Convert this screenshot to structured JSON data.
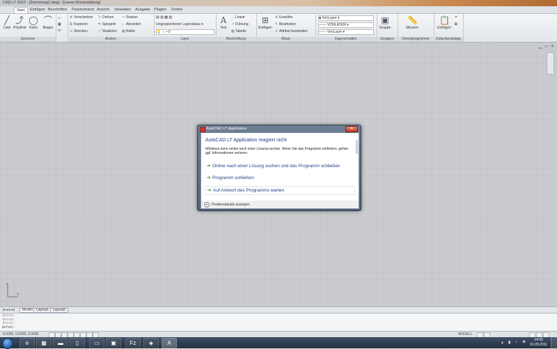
{
  "window": {
    "title": "CAD LT 2010 - [Zeichnung1.dwg] - [Leerer Rückmeldung]"
  },
  "ribbon_tabs": [
    "Start",
    "Einfügen",
    "Beschriften",
    "Parametrisch",
    "Ansicht",
    "Verwalten",
    "Ausgabe",
    "Plugins",
    "Online"
  ],
  "ribbon": {
    "zeichnen": {
      "title": "Zeichnen",
      "buttons": [
        "Linie",
        "Polylinie",
        "Kreis",
        "Bogen"
      ]
    },
    "aendern": {
      "title": "Ändern",
      "items": [
        "Verschieben",
        "Drehen",
        "Stutzen",
        "Kopieren",
        "Spiegeln",
        "Abrunden",
        "Strecken",
        "Skalieren",
        "Reihe"
      ]
    },
    "layer": {
      "title": "Layer",
      "items": [
        "Ungespeicherter Layerstatus",
        "0"
      ]
    },
    "beschriftung": {
      "title": "Beschriftung",
      "text_button": "Text",
      "items": [
        "Linear",
        "Führung",
        "Tabelle"
      ]
    },
    "block": {
      "title": "Block",
      "insert_button": "Einfügen",
      "items": [
        "Erstellen",
        "Bearbeiten",
        "Attribut bearbeiten"
      ]
    },
    "eigenschaften": {
      "title": "Eigenschaften",
      "items": [
        "VonLayer",
        "VONLAYER",
        "VonLayer"
      ]
    },
    "gruppen": {
      "title": "Gruppen",
      "button": "Gruppe"
    },
    "dienstprogramme": {
      "title": "Dienstprogramme",
      "button": "Messen"
    },
    "zwischenablage": {
      "title": "Zwischenablage",
      "button": "Einfügen"
    }
  },
  "layout_tabs": [
    "Modell",
    "Layout1",
    "Layout2"
  ],
  "command": {
    "history": [
      "Befehl:",
      "Befehl:",
      "Befehl:"
    ],
    "prompt": "Befehl:"
  },
  "statusbar": {
    "coords": "0.0000, 0.0000, 0.0000",
    "right_label": "MODELL"
  },
  "dialog": {
    "title": "AutoCAD LT Application",
    "close_symbol": "✕",
    "main_instruction": "AutoCAD LT Application reagiert nicht",
    "content": "Windows kann online nach einer Lösung suchen. Wenn Sie das Programm schließen, gehen ggf. Informationen verloren.",
    "options": [
      "Online nach einer Lösung suchen und das Programm schließen",
      "Programm schließen",
      "Auf Antwort des Programms warten"
    ],
    "details_label": "Problemdetails anzeigen"
  },
  "taskbar": {
    "time": "14:55",
    "date": "01.09.2011"
  },
  "colors": {
    "dialog_instruction": "#1f3d8a",
    "option_arrow": "#2aa52a",
    "close_button": "#c0392b",
    "canvas": "#c9cbcf"
  }
}
